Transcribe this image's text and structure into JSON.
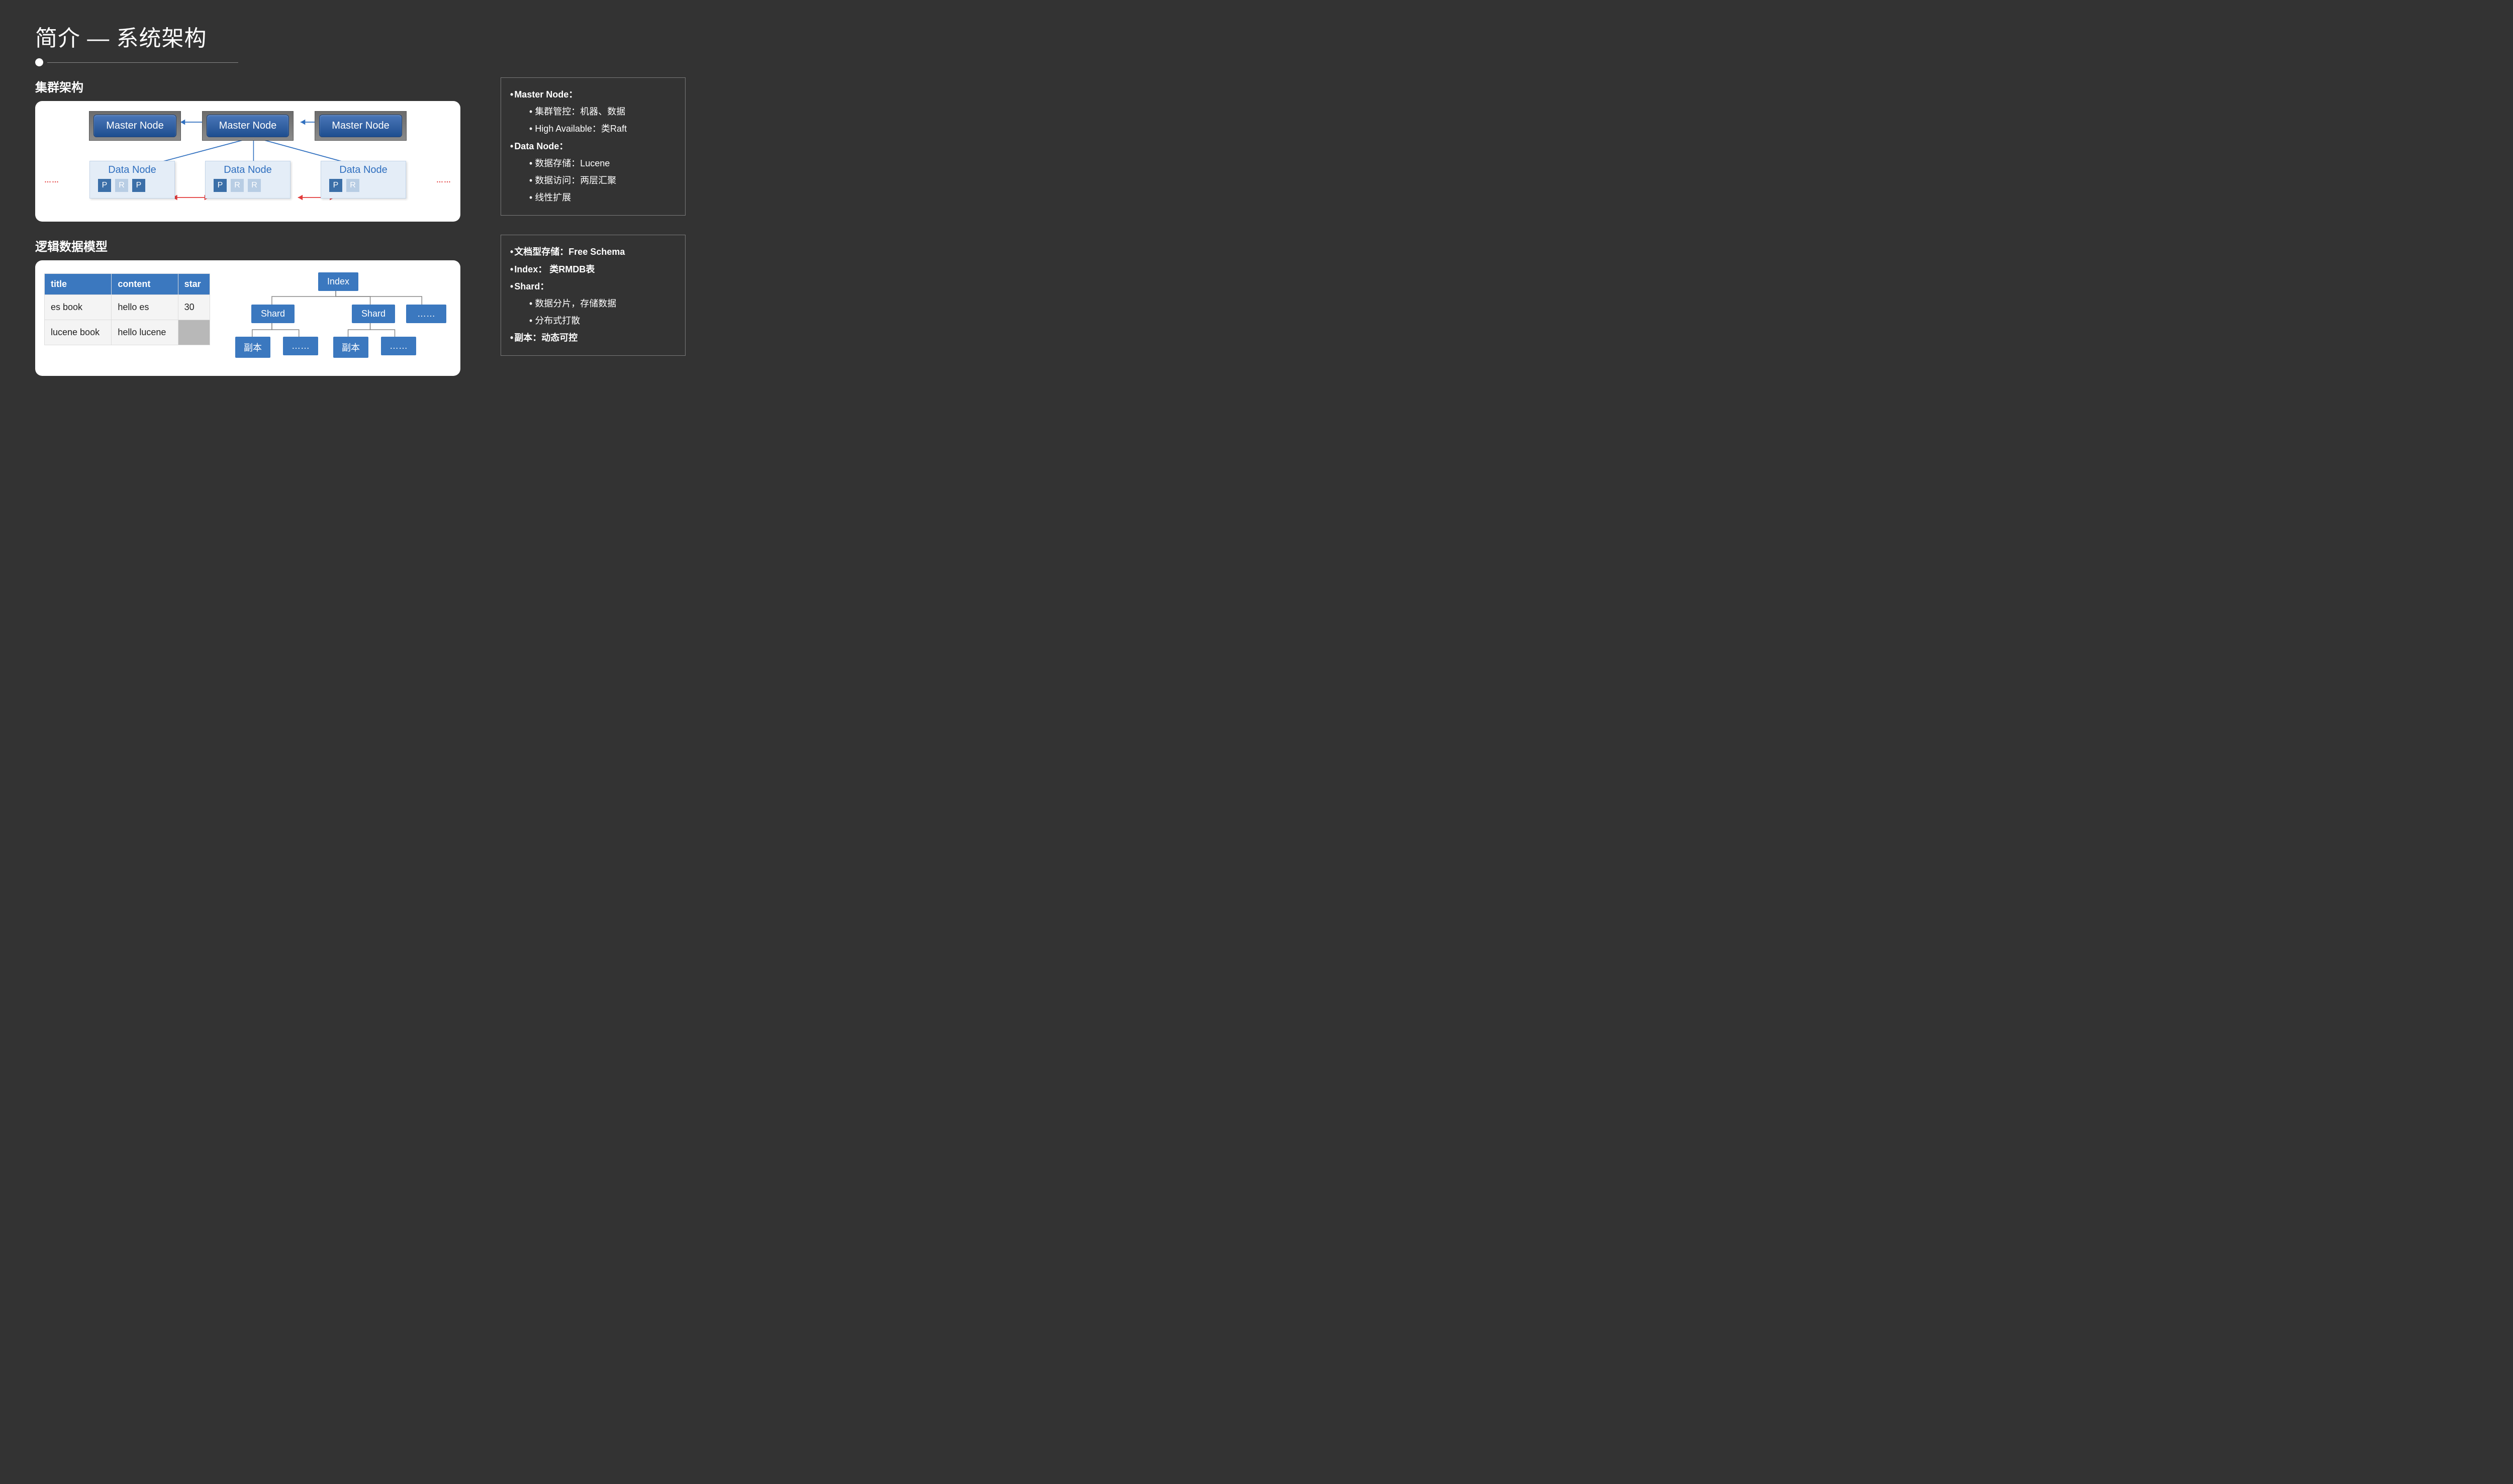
{
  "title": "简介 — 系统架构",
  "section1_heading": "集群架构",
  "section2_heading": "逻辑数据模型",
  "cluster": {
    "master_label": "Master Node",
    "data_label": "Data Node",
    "shard_p": "P",
    "shard_r": "R",
    "dots": "……",
    "data_nodes": [
      {
        "shards": [
          "P",
          "R",
          "P"
        ]
      },
      {
        "shards": [
          "P",
          "R",
          "R"
        ]
      },
      {
        "shards": [
          "P",
          "R"
        ]
      }
    ]
  },
  "table": {
    "headers": [
      "title",
      "content",
      "star"
    ],
    "rows": [
      [
        "es book",
        "hello es",
        "30"
      ],
      [
        "lucene book",
        "hello lucene",
        ""
      ]
    ]
  },
  "tree": {
    "root": "Index",
    "shard": "Shard",
    "ellipsis": "……",
    "replica": "副本"
  },
  "info1": {
    "h1": "Master Node：",
    "h1_items": [
      "集群管控：机器、数据",
      "High Available：类Raft"
    ],
    "h2": "Data Node：",
    "h2_items": [
      "数据存储：Lucene",
      "数据访问：两层汇聚",
      "线性扩展"
    ]
  },
  "info2": {
    "l1": "文档型存储：Free Schema",
    "l2": "Index： 类RMDB表",
    "l3": "Shard：",
    "l3_items": [
      "数据分片，存储数据",
      "分布式打散"
    ],
    "l4": "副本：动态可控"
  }
}
